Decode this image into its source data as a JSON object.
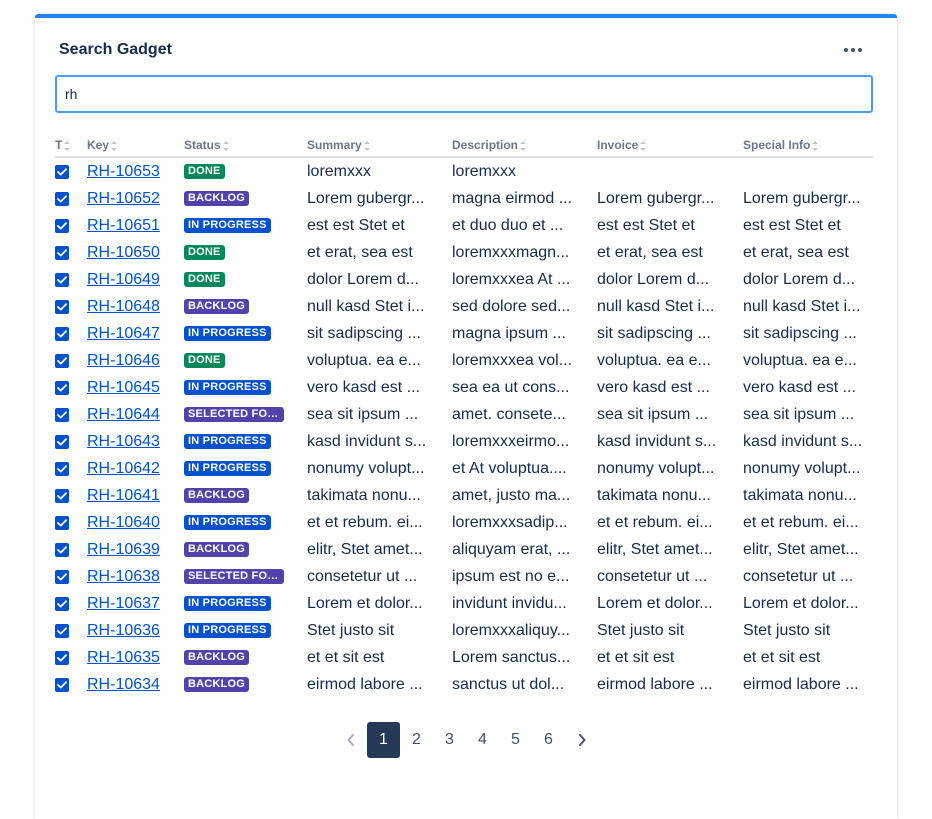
{
  "gadget": {
    "title": "Search Gadget",
    "more_icon": "more-horizontal-icon"
  },
  "search": {
    "value": "rh",
    "placeholder": ""
  },
  "columns": [
    "T",
    "Key",
    "Status",
    "Summary",
    "Description",
    "Invoice",
    "Special Info"
  ],
  "status_colors": {
    "DONE": "#00875a",
    "BACKLOG": "#5243aa",
    "IN PROGRESS": "#0052cc",
    "SELECTED FOR DEVELOPMENT": "#5243aa"
  },
  "rows": [
    {
      "checked": true,
      "key": "RH-10653",
      "status": "DONE",
      "summary": "loremxxx",
      "description": "loremxxx",
      "invoice": "",
      "special": ""
    },
    {
      "checked": true,
      "key": "RH-10652",
      "status": "BACKLOG",
      "summary": "Lorem gubergr...",
      "description": "magna eirmod ...",
      "invoice": "Lorem gubergr...",
      "special": "Lorem gubergr..."
    },
    {
      "checked": true,
      "key": "RH-10651",
      "status": "IN PROGRESS",
      "summary": "est est Stet et",
      "description": "et duo duo et ...",
      "invoice": "est est Stet et",
      "special": "est est Stet et"
    },
    {
      "checked": true,
      "key": "RH-10650",
      "status": "DONE",
      "summary": "et erat, sea est",
      "description": "loremxxxmagn...",
      "invoice": "et erat, sea est",
      "special": "et erat, sea est"
    },
    {
      "checked": true,
      "key": "RH-10649",
      "status": "DONE",
      "summary": "dolor Lorem d...",
      "description": "loremxxxea At ...",
      "invoice": "dolor Lorem d...",
      "special": "dolor Lorem d..."
    },
    {
      "checked": true,
      "key": "RH-10648",
      "status": "BACKLOG",
      "summary": "null kasd Stet i...",
      "description": "sed dolore sed...",
      "invoice": "null kasd Stet i...",
      "special": "null kasd Stet i..."
    },
    {
      "checked": true,
      "key": "RH-10647",
      "status": "IN PROGRESS",
      "summary": "sit sadipscing ...",
      "description": "magna ipsum ...",
      "invoice": "sit sadipscing ...",
      "special": "sit sadipscing ..."
    },
    {
      "checked": true,
      "key": "RH-10646",
      "status": "DONE",
      "summary": "voluptua. ea e...",
      "description": "loremxxxea vol...",
      "invoice": "voluptua. ea e...",
      "special": "voluptua. ea e..."
    },
    {
      "checked": true,
      "key": "RH-10645",
      "status": "IN PROGRESS",
      "summary": "vero kasd est ...",
      "description": "sea ea ut cons...",
      "invoice": "vero kasd est ...",
      "special": "vero kasd est ..."
    },
    {
      "checked": true,
      "key": "RH-10644",
      "status": "SELECTED FOR DEVELOPMENT",
      "summary": "sea sit ipsum ...",
      "description": "amet. consete...",
      "invoice": "sea sit ipsum ...",
      "special": "sea sit ipsum ..."
    },
    {
      "checked": true,
      "key": "RH-10643",
      "status": "IN PROGRESS",
      "summary": "kasd invidunt s...",
      "description": "loremxxxeirmo...",
      "invoice": "kasd invidunt s...",
      "special": "kasd invidunt s..."
    },
    {
      "checked": true,
      "key": "RH-10642",
      "status": "IN PROGRESS",
      "summary": "nonumy volupt...",
      "description": "et At voluptua....",
      "invoice": "nonumy volupt...",
      "special": "nonumy volupt..."
    },
    {
      "checked": true,
      "key": "RH-10641",
      "status": "BACKLOG",
      "summary": "takimata nonu...",
      "description": "amet, justo ma...",
      "invoice": "takimata nonu...",
      "special": "takimata nonu..."
    },
    {
      "checked": true,
      "key": "RH-10640",
      "status": "IN PROGRESS",
      "summary": "et et rebum. ei...",
      "description": "loremxxxsadip...",
      "invoice": "et et rebum. ei...",
      "special": "et et rebum. ei..."
    },
    {
      "checked": true,
      "key": "RH-10639",
      "status": "BACKLOG",
      "summary": "elitr, Stet amet...",
      "description": "aliquyam erat, ...",
      "invoice": "elitr, Stet amet...",
      "special": "elitr, Stet amet..."
    },
    {
      "checked": true,
      "key": "RH-10638",
      "status": "SELECTED FOR DEVELOPMENT",
      "summary": "consetetur ut ...",
      "description": "ipsum est no e...",
      "invoice": "consetetur ut ...",
      "special": "consetetur ut ..."
    },
    {
      "checked": true,
      "key": "RH-10637",
      "status": "IN PROGRESS",
      "summary": "Lorem et dolor...",
      "description": "invidunt invidu...",
      "invoice": "Lorem et dolor...",
      "special": "Lorem et dolor..."
    },
    {
      "checked": true,
      "key": "RH-10636",
      "status": "IN PROGRESS",
      "summary": "Stet justo sit",
      "description": "loremxxxaliquy...",
      "invoice": "Stet justo sit",
      "special": "Stet justo sit"
    },
    {
      "checked": true,
      "key": "RH-10635",
      "status": "BACKLOG",
      "summary": "et et sit est",
      "description": "Lorem sanctus...",
      "invoice": "et et sit est",
      "special": "et et sit est"
    },
    {
      "checked": true,
      "key": "RH-10634",
      "status": "BACKLOG",
      "summary": "eirmod labore ...",
      "description": "sanctus ut dol...",
      "invoice": "eirmod labore ...",
      "special": "eirmod labore ..."
    }
  ],
  "pagination": {
    "pages": [
      "1",
      "2",
      "3",
      "4",
      "5",
      "6"
    ],
    "current": "1",
    "prev_icon": "chevron-left-icon",
    "next_icon": "chevron-right-icon"
  }
}
